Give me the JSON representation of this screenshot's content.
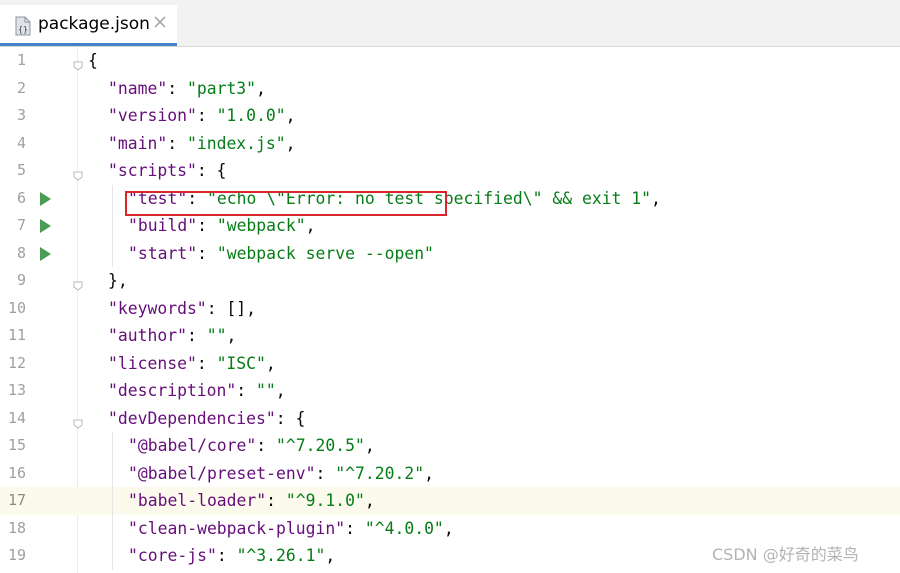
{
  "tab": {
    "file_name": "package.json",
    "icon": "json-file-icon"
  },
  "editor": {
    "current_line": 17,
    "lines": [
      {
        "n": "1",
        "indent": 0,
        "tokens": [
          [
            "p",
            "{"
          ]
        ],
        "fold": true
      },
      {
        "n": "2",
        "indent": 1,
        "tokens": [
          [
            "k",
            "\"name\""
          ],
          [
            "p",
            ": "
          ],
          [
            "s",
            "\"part3\""
          ],
          [
            "p",
            ","
          ]
        ]
      },
      {
        "n": "3",
        "indent": 1,
        "tokens": [
          [
            "k",
            "\"version\""
          ],
          [
            "p",
            ": "
          ],
          [
            "s",
            "\"1.0.0\""
          ],
          [
            "p",
            ","
          ]
        ]
      },
      {
        "n": "4",
        "indent": 1,
        "tokens": [
          [
            "k",
            "\"main\""
          ],
          [
            "p",
            ": "
          ],
          [
            "s",
            "\"index.js\""
          ],
          [
            "p",
            ","
          ]
        ]
      },
      {
        "n": "5",
        "indent": 1,
        "tokens": [
          [
            "k",
            "\"scripts\""
          ],
          [
            "p",
            ": {"
          ]
        ],
        "fold": true
      },
      {
        "n": "6",
        "indent": 2,
        "tokens": [
          [
            "k",
            "\"test\""
          ],
          [
            "p",
            ": "
          ],
          [
            "s",
            "\"echo \\\"Error: no test specified\\\" && exit 1\""
          ],
          [
            "p",
            ","
          ]
        ],
        "run": true
      },
      {
        "n": "7",
        "indent": 2,
        "tokens": [
          [
            "k",
            "\"build\""
          ],
          [
            "p",
            ": "
          ],
          [
            "s",
            "\"webpack\""
          ],
          [
            "p",
            ","
          ]
        ],
        "run": true
      },
      {
        "n": "8",
        "indent": 2,
        "tokens": [
          [
            "k",
            "\"start\""
          ],
          [
            "p",
            ": "
          ],
          [
            "s",
            "\"webpack serve --open\""
          ]
        ],
        "run": true
      },
      {
        "n": "9",
        "indent": 1,
        "tokens": [
          [
            "p",
            "},"
          ]
        ],
        "fold": true
      },
      {
        "n": "10",
        "indent": 1,
        "tokens": [
          [
            "k",
            "\"keywords\""
          ],
          [
            "p",
            ": [],"
          ]
        ]
      },
      {
        "n": "11",
        "indent": 1,
        "tokens": [
          [
            "k",
            "\"author\""
          ],
          [
            "p",
            ": "
          ],
          [
            "s",
            "\"\""
          ],
          [
            "p",
            ","
          ]
        ]
      },
      {
        "n": "12",
        "indent": 1,
        "tokens": [
          [
            "k",
            "\"license\""
          ],
          [
            "p",
            ": "
          ],
          [
            "s",
            "\"ISC\""
          ],
          [
            "p",
            ","
          ]
        ]
      },
      {
        "n": "13",
        "indent": 1,
        "tokens": [
          [
            "k",
            "\"description\""
          ],
          [
            "p",
            ": "
          ],
          [
            "s",
            "\"\""
          ],
          [
            "p",
            ","
          ]
        ]
      },
      {
        "n": "14",
        "indent": 1,
        "tokens": [
          [
            "k",
            "\"devDependencies\""
          ],
          [
            "p",
            ": {"
          ]
        ],
        "fold": true
      },
      {
        "n": "15",
        "indent": 2,
        "tokens": [
          [
            "k",
            "\"@babel/core\""
          ],
          [
            "p",
            ": "
          ],
          [
            "s",
            "\"^7.20.5\""
          ],
          [
            "p",
            ","
          ]
        ]
      },
      {
        "n": "16",
        "indent": 2,
        "tokens": [
          [
            "k",
            "\"@babel/preset-env\""
          ],
          [
            "p",
            ": "
          ],
          [
            "s",
            "\"^7.20.2\""
          ],
          [
            "p",
            ","
          ]
        ]
      },
      {
        "n": "17",
        "indent": 2,
        "tokens": [
          [
            "k",
            "\"babel-loader\""
          ],
          [
            "p",
            ": "
          ],
          [
            "s",
            "\"^9.1.0\""
          ],
          [
            "p",
            ","
          ]
        ]
      },
      {
        "n": "18",
        "indent": 2,
        "tokens": [
          [
            "k",
            "\"clean-webpack-plugin\""
          ],
          [
            "p",
            ": "
          ],
          [
            "s",
            "\"^4.0.0\""
          ],
          [
            "p",
            ","
          ]
        ]
      },
      {
        "n": "19",
        "indent": 2,
        "tokens": [
          [
            "k",
            "\"core-js\""
          ],
          [
            "p",
            ": "
          ],
          [
            "s",
            "\"^3.26.1\""
          ],
          [
            "p",
            ","
          ]
        ]
      }
    ]
  },
  "watermark": "CSDN @好奇的菜鸟",
  "colors": {
    "key": "#660e7a",
    "string": "#067d17",
    "tab_accent": "#4083c9",
    "highlight_box": "#d9262c",
    "run_gutter": "#499c54"
  }
}
